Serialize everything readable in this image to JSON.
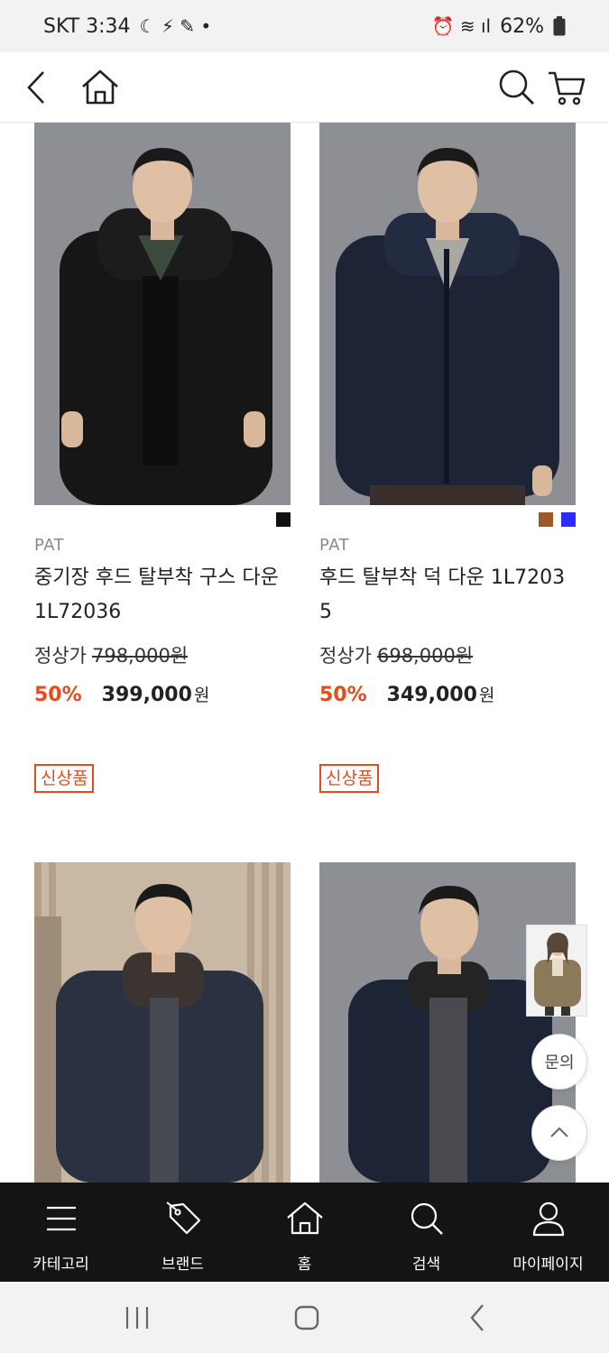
{
  "status_bar": {
    "carrier_time": "SKT 3:34",
    "extra_icons": "☾ ⚡ ✎ •",
    "right_icons": "⏰ ≋ ıl",
    "battery": "62%"
  },
  "header": {
    "back_icon": "chevron-left-icon",
    "home_icon": "home-icon",
    "search_icon": "search-icon",
    "cart_icon": "cart-icon"
  },
  "products": [
    {
      "brand": "PAT",
      "name": "중기장 후드 탈부착 구스 다운 1L72036",
      "regular_label": "정상가",
      "regular_price": "798,000원",
      "discount": "50%",
      "sale_price": "399,000",
      "currency": "원",
      "badge": "신상품",
      "swatches": [
        "#111111"
      ]
    },
    {
      "brand": "PAT",
      "name": "후드 탈부착 덕 다운 1L72035",
      "regular_label": "정상가",
      "regular_price": "698,000원",
      "discount": "50%",
      "sale_price": "349,000",
      "currency": "원",
      "badge": "신상품",
      "swatches": [
        "#a0592a",
        "#2b2bff"
      ]
    }
  ],
  "floating": {
    "inquiry_label": "문의",
    "top_icon": "chevron-up-icon"
  },
  "bottom_nav": [
    {
      "label": "카테고리",
      "icon": "menu-icon"
    },
    {
      "label": "브랜드",
      "icon": "tag-icon"
    },
    {
      "label": "홈",
      "icon": "home-icon"
    },
    {
      "label": "검색",
      "icon": "search-icon"
    },
    {
      "label": "마이페이지",
      "icon": "user-icon"
    }
  ],
  "colors": {
    "accent": "#e84a19",
    "nav_background": "#141414",
    "product_backdrop": "#8e8f94"
  }
}
